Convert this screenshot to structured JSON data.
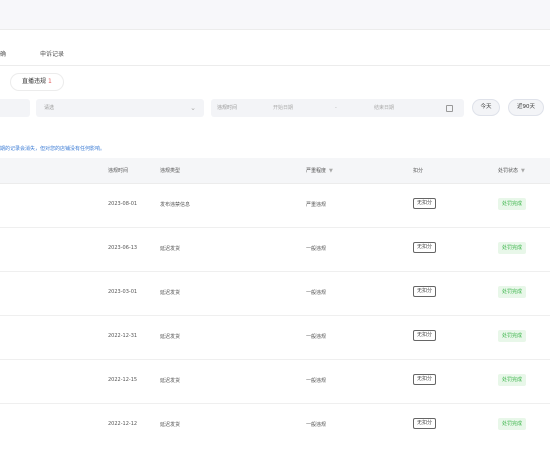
{
  "tabs": {
    "a": "确",
    "b": "申诉记录"
  },
  "subtab": {
    "label": "直播违规",
    "count": "1"
  },
  "filters": {
    "select_placeholder": "请选",
    "date_label": "违规时间",
    "start_placeholder": "开始日期",
    "separator": "-",
    "end_placeholder": "结束日期",
    "today": "今天",
    "last90": "近90天"
  },
  "notice": "期的记录会消失，但对您的店铺没有任何影响。",
  "table": {
    "headers": {
      "time": "违规时间",
      "type": "违规类型",
      "severity": "严重程度",
      "score": "扣分",
      "status": "处罚状态"
    },
    "rows": [
      {
        "time": "2023-08-01",
        "type": "发布违禁信息",
        "severity": "严重违规",
        "score": "无扣分",
        "status": "处罚完成"
      },
      {
        "time": "2023-06-13",
        "type": "延迟发货",
        "severity": "一般违规",
        "score": "无扣分",
        "status": "处罚完成"
      },
      {
        "time": "2023-03-01",
        "type": "延迟发货",
        "severity": "一般违规",
        "score": "无扣分",
        "status": "处罚完成"
      },
      {
        "time": "2022-12-31",
        "type": "延迟发货",
        "severity": "一般违规",
        "score": "无扣分",
        "status": "处罚完成"
      },
      {
        "time": "2022-12-15",
        "type": "延迟发货",
        "severity": "一般违规",
        "score": "无扣分",
        "status": "处罚完成"
      },
      {
        "time": "2022-12-12",
        "type": "延迟发货",
        "severity": "一般违规",
        "score": "无扣分",
        "status": "处罚完成"
      }
    ]
  },
  "colors": {
    "notice": "#3a7bd5",
    "count": "#e05a5a",
    "status_green": "#3bb54a",
    "status_bg": "#e8f7e9"
  },
  "icons": {
    "chevron": "chevron-down-icon",
    "calendar": "calendar-icon",
    "filter": "filter-icon"
  }
}
